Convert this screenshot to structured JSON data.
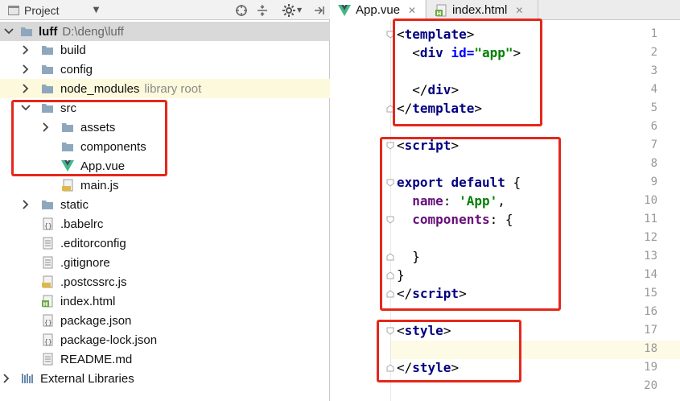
{
  "project_panel": {
    "title": "Project",
    "root": {
      "name": "luff",
      "path": "D:\\deng\\luff"
    },
    "items": [
      {
        "label": "build",
        "kind": "folder",
        "expandable": true
      },
      {
        "label": "config",
        "kind": "folder",
        "expandable": true
      },
      {
        "label": "node_modules",
        "extra": "library root",
        "kind": "folder",
        "expandable": true
      },
      {
        "label": "src",
        "kind": "folder",
        "expanded": true
      },
      {
        "label": "assets",
        "kind": "folder",
        "expandable": true
      },
      {
        "label": "components",
        "kind": "folder"
      },
      {
        "label": "App.vue",
        "kind": "vue"
      },
      {
        "label": "main.js",
        "kind": "js"
      },
      {
        "label": "static",
        "kind": "folder",
        "expandable": true
      },
      {
        "label": ".babelrc",
        "kind": "json"
      },
      {
        "label": ".editorconfig",
        "kind": "text"
      },
      {
        "label": ".gitignore",
        "kind": "text"
      },
      {
        "label": ".postcssrc.js",
        "kind": "js"
      },
      {
        "label": "index.html",
        "kind": "html"
      },
      {
        "label": "package.json",
        "kind": "json"
      },
      {
        "label": "package-lock.json",
        "kind": "json"
      },
      {
        "label": "README.md",
        "kind": "md"
      }
    ],
    "external": "External Libraries"
  },
  "editor": {
    "tabs": [
      {
        "label": "App.vue",
        "active": true
      },
      {
        "label": "index.html",
        "active": false
      }
    ],
    "line_numbers": [
      "1",
      "2",
      "3",
      "4",
      "5",
      "6",
      "7",
      "8",
      "9",
      "10",
      "11",
      "12",
      "13",
      "14",
      "15",
      "16",
      "17",
      "18",
      "19",
      "20"
    ],
    "code": {
      "l1_tag": "template",
      "l2_tag": "div",
      "l2_attr": "id",
      "l2_val": "\"app\"",
      "l4_tag": "div",
      "l5_tag": "template",
      "l7_tag": "script",
      "l9_kw1": "export",
      "l9_kw2": "default",
      "l10_prop": "name",
      "l10_val": "'App'",
      "l11_prop": "components",
      "l15_tag": "script",
      "l17_tag": "style",
      "l19_tag": "style"
    }
  },
  "colors": {
    "annotation": "#e4281b",
    "vue_green": "#41b883",
    "folder": "#8fa7bd"
  }
}
